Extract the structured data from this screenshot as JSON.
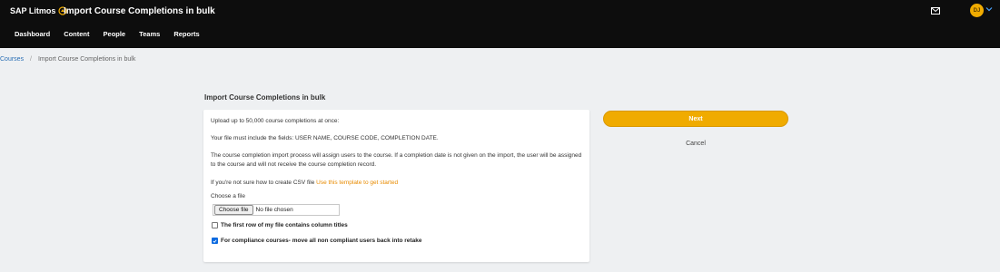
{
  "header": {
    "brand": "SAP Litmos",
    "app_title": "Import Course Completions in bulk",
    "avatar_initials": "DJ",
    "avatar_color": "#f0ab00"
  },
  "nav": {
    "items": [
      {
        "label": "Dashboard"
      },
      {
        "label": "Content"
      },
      {
        "label": "People"
      },
      {
        "label": "Teams"
      },
      {
        "label": "Reports"
      }
    ]
  },
  "breadcrumb": {
    "parent": "Courses",
    "separator": "/",
    "current": "Import Course Completions in bulk"
  },
  "page": {
    "title": "Import Course Completions in bulk"
  },
  "form": {
    "intro": "Upload up to 50,000 course completions at once:",
    "fields_note": "Your file must include the fields: USER NAME, COURSE CODE, COMPLETION DATE.",
    "process_note": "The course completion import process will assign users to the course. If a completion date is not given on the import, the user will be assigned to the course and will not receive the course completion record.",
    "csv_help_prefix": "If you're not sure how to create CSV file",
    "csv_help_link": "Use this template to get started",
    "choose_file_label": "Choose a file",
    "choose_file_button": "Choose file",
    "file_status": "No file chosen",
    "checkbox_header_row": {
      "label": "The first row of my file contains column titles",
      "checked": false
    },
    "checkbox_compliance": {
      "label": "For compliance courses- move all non compliant users back into retake",
      "checked": true
    }
  },
  "actions": {
    "next": "Next",
    "cancel": "Cancel",
    "accent_color": "#f0ab00"
  },
  "icons": {
    "mail": "mail-icon",
    "chevron": "chevron-down-icon",
    "brand_mark": "litmos-logo-icon",
    "check": "checkmark-icon"
  }
}
